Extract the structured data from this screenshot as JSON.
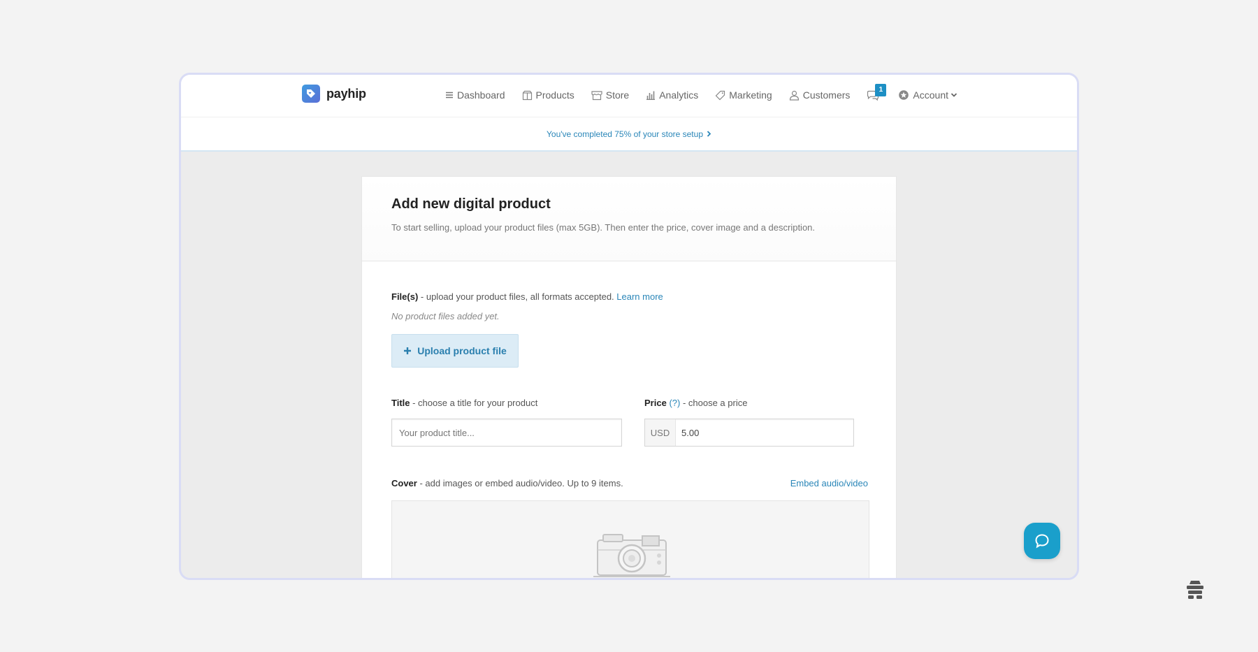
{
  "brand": {
    "name": "payhip",
    "logo_icon": "tag-heart-icon",
    "accent": "#1d8fc4"
  },
  "nav": {
    "items": [
      {
        "label": "Dashboard",
        "icon": "list-icon"
      },
      {
        "label": "Products",
        "icon": "box-icon"
      },
      {
        "label": "Store",
        "icon": "store-icon"
      },
      {
        "label": "Analytics",
        "icon": "bar-chart-icon"
      },
      {
        "label": "Marketing",
        "icon": "tag-icon"
      },
      {
        "label": "Customers",
        "icon": "user-icon"
      }
    ],
    "messages_badge": "1",
    "account_label": "Account"
  },
  "setup": {
    "text": "You've completed 75% of your store setup"
  },
  "page": {
    "title": "Add new digital product",
    "subtitle": "To start selling, upload your product files (max 5GB). Then enter the price, cover image and a description."
  },
  "files": {
    "label": "File(s)",
    "hint": " - upload your product files, all formats accepted. ",
    "learn_more": "Learn more",
    "empty_note": "No product files added yet.",
    "upload_button": "Upload product file"
  },
  "title_field": {
    "label": "Title",
    "hint": " - choose a title for your product",
    "placeholder": "Your product title...",
    "value": ""
  },
  "price_field": {
    "label": "Price",
    "help": "(?)",
    "hint": " - choose a price",
    "currency": "USD",
    "value": "5.00"
  },
  "cover": {
    "label": "Cover",
    "hint": " - add images or embed audio/video. Up to 9 items.",
    "embed_link": "Embed audio/video"
  }
}
